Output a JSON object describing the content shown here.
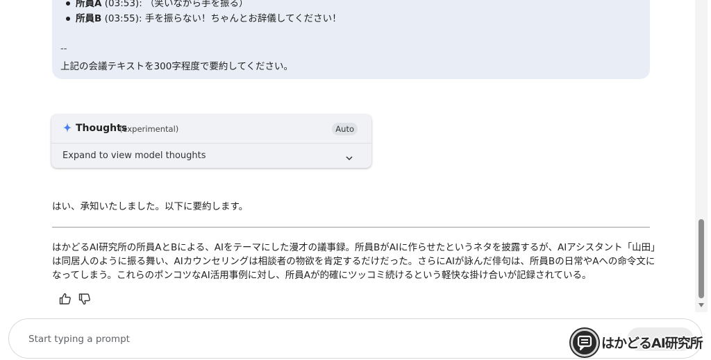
{
  "user_message": {
    "transcript_tail": [
      {
        "speaker": "所員A",
        "time": "(03:53):",
        "text": "（笑いながら手を振る）"
      },
      {
        "speaker": "所員B",
        "time": "(03:55):",
        "text": "手を振らない！ちゃんとお辞儀してください！"
      }
    ],
    "separator": "--",
    "instruction": "上記の会議テキストを300字程度で要約してください。"
  },
  "thoughts": {
    "icon": "sparkle-icon",
    "title": "Thoughts",
    "subtitle": "(experimental)",
    "mode_chip": "Auto",
    "expand_label": "Expand to view model thoughts"
  },
  "response": {
    "intro": "はい、承知いたしました。以下に要約します。",
    "summary": "はかどるAI研究所の所員AとBによる、AIをテーマにした漫才の議事録。所員BがAIに作らせたというネタを披露するが、AIアシスタント「山田」は同居人のように振る舞い、AIカウンセリングは相談者の物欲を肯定するだけだった。さらにAIが詠んだ俳句は、所員Bの日常やAへの命令文になってしまう。これらのポンコツなAI活用事例に対し、所員Aが的確にツッコミ続けるという軽快な掛け合いが記録されている。"
  },
  "prompt": {
    "placeholder": "Start typing a prompt"
  },
  "watermark": {
    "text": "はかどるAI研究所"
  },
  "colors": {
    "user_bubble": "#e9eef6",
    "sparkle": "#4c7cf0",
    "thoughts_card": "#f0f2f5"
  }
}
